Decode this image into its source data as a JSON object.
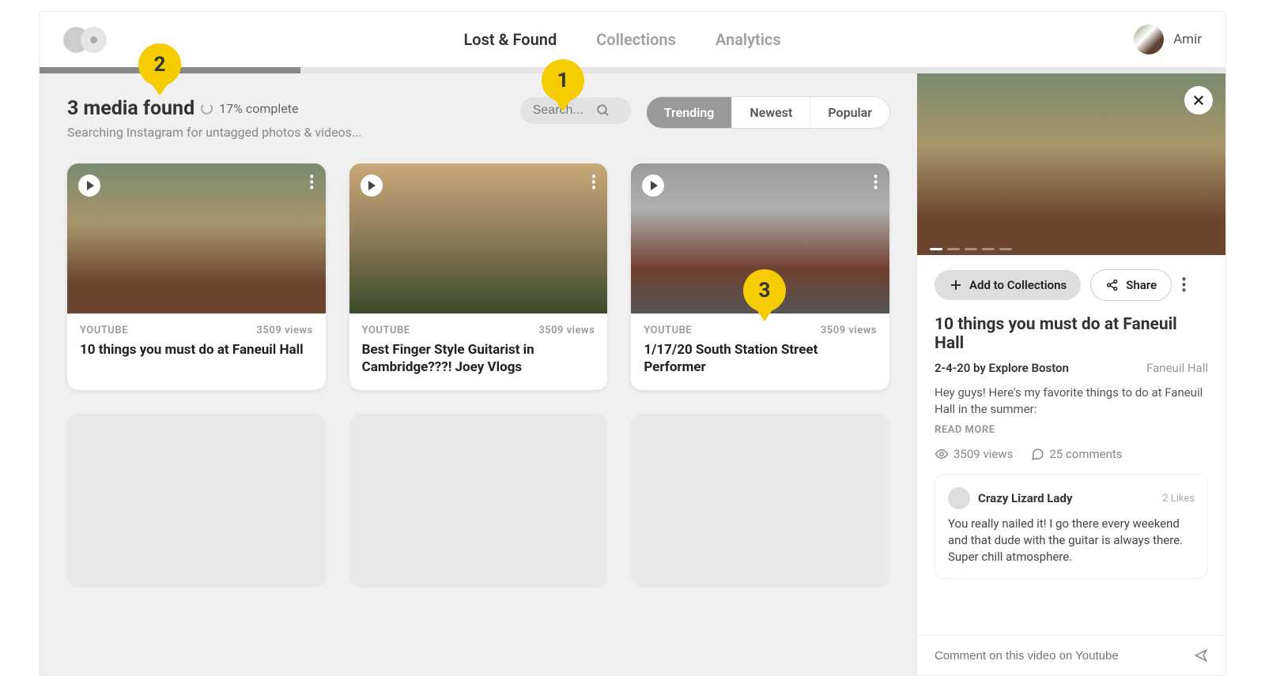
{
  "header": {
    "nav": [
      {
        "label": "Lost & Found",
        "active": true
      },
      {
        "label": "Collections",
        "active": false
      },
      {
        "label": "Analytics",
        "active": false
      }
    ],
    "username": "Amir"
  },
  "progress": {
    "percent": 17
  },
  "results": {
    "title": "3 media found",
    "completion": "17% complete",
    "subtitle": "Searching Instagram for untagged photos & videos..."
  },
  "search": {
    "placeholder": "Search..."
  },
  "segments": [
    "Trending",
    "Newest",
    "Popular"
  ],
  "segment_active": 0,
  "cards": [
    {
      "source": "YOUTUBE",
      "views": "3509 views",
      "title": "10 things you must do at Faneuil Hall"
    },
    {
      "source": "YOUTUBE",
      "views": "3509 views",
      "title": "Best Finger Style Guitarist in Cambridge???! Joey Vlogs"
    },
    {
      "source": "YOUTUBE",
      "views": "3509 views",
      "title": "1/17/20 South Station Street Performer"
    }
  ],
  "detail": {
    "add_label": "Add to Collections",
    "share_label": "Share",
    "title": "10 things you must do at Faneuil Hall",
    "byline": "2-4-20 by Explore Boston",
    "location": "Faneuil Hall",
    "description": "Hey guys! Here's my favorite things to do at Faneuil Hall in the summer:",
    "read_more": "READ MORE",
    "views": "3509 views",
    "comments": "25 comments",
    "comment": {
      "author": "Crazy Lizard Lady",
      "likes": "2 Likes",
      "body": "You really nailed it! I go there every weekend and that dude with the guitar is always there. Super chill atmosphere."
    },
    "comment_placeholder": "Comment on this video on Youtube"
  },
  "annotations": [
    "1",
    "2",
    "3"
  ]
}
